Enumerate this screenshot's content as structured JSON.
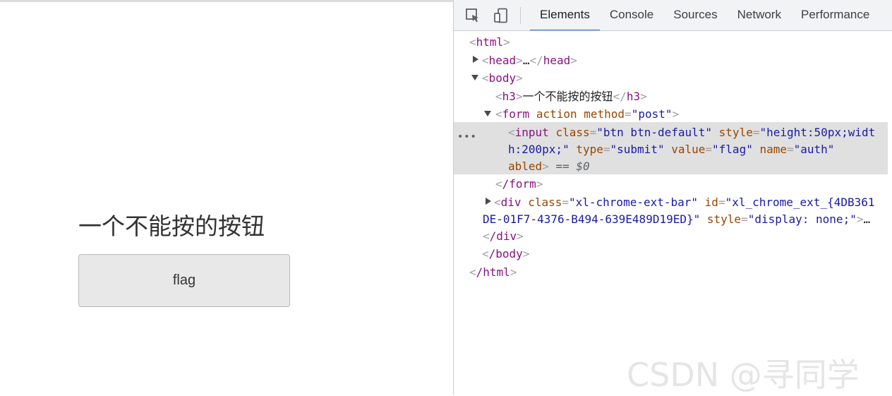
{
  "page": {
    "heading": "一个不能按的按钮",
    "button_value": "flag"
  },
  "devtools": {
    "icons": [
      "element-picker-icon",
      "device-toggle-icon"
    ],
    "tabs": [
      "Elements",
      "Console",
      "Sources",
      "Network",
      "Performance"
    ],
    "active_tab": "Elements",
    "tree": {
      "html_open": "html",
      "head": "head",
      "head_ellipsis": "…",
      "body_open": "body",
      "h3_tag": "h3",
      "h3_text": "一个不能按的按钮",
      "form_tag": "form",
      "form_attr_action": "action",
      "form_attr_method": "method",
      "form_method_value": "\"post\"",
      "input_tag": "input",
      "input_attr_class": "class",
      "input_class_value": "\"btn btn-default\"",
      "input_attr_style": "style",
      "input_style_value_1": "\"height:50px;widt",
      "input_style_value_2": "h:200px;\"",
      "input_attr_type": "type",
      "input_type_value": "\"submit\"",
      "input_attr_value": "value",
      "input_value_value": "\"flag\"",
      "input_attr_name": "name",
      "input_name_value": "\"auth\"",
      "input_attr_disabled": "abled",
      "selected_marker": "== $0",
      "form_close": "/form",
      "div_tag": "div",
      "div_attr_class": "class",
      "div_class_value": "\"xl-chrome-ext-bar\"",
      "div_attr_id": "id",
      "div_id_value_1": "\"xl_chrome_ext_{4DB361",
      "div_id_value_2": "DE-01F7-4376-B494-639E489D19ED}\"",
      "div_attr_style": "style",
      "div_style_value": "\"display: none;\"",
      "div_ellipsis": "…",
      "div_close": "/div",
      "body_close": "/body",
      "html_close": "/html"
    },
    "row_menu_glyph": "•••"
  },
  "watermark": "CSDN @寻同学"
}
